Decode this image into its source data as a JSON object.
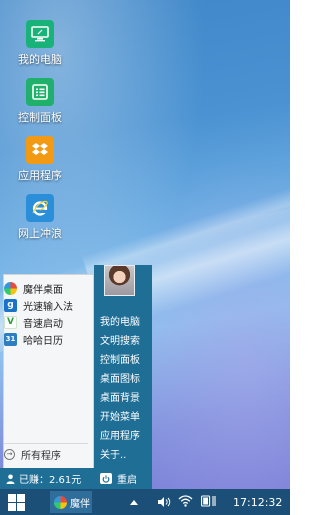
{
  "desktop_icons": [
    {
      "label": "我的电脑",
      "icon": "computer-icon",
      "color": "#19b37a"
    },
    {
      "label": "控制面板",
      "icon": "control-panel-icon",
      "color": "#1fb06b"
    },
    {
      "label": "应用程序",
      "icon": "dropbox-icon",
      "color": "#f29a14"
    },
    {
      "label": "网上冲浪",
      "icon": "ie-browser-icon",
      "color": "#2a8fd8"
    }
  ],
  "start_menu": {
    "apps": [
      {
        "label": "魔伴桌面",
        "icon": "pinwheel-icon"
      },
      {
        "label": "光速输入法",
        "icon": "g-input-icon"
      },
      {
        "label": "音速启动",
        "icon": "v-launch-icon"
      },
      {
        "label": "哈哈日历",
        "icon": "calendar-icon"
      }
    ],
    "all_programs": "所有程序",
    "right_links": [
      "我的电脑",
      "文明搜索",
      "控制面板",
      "桌面图标",
      "桌面背景",
      "开始菜单",
      "应用程序",
      "关于.."
    ],
    "earned": "已赚：2.61元",
    "restart": "重启"
  },
  "taskbar": {
    "app_label": "魔伴",
    "time": "17:12:32"
  },
  "colors": {
    "menu_accent": "#1e6e96",
    "taskbar": "#1b4f77"
  }
}
